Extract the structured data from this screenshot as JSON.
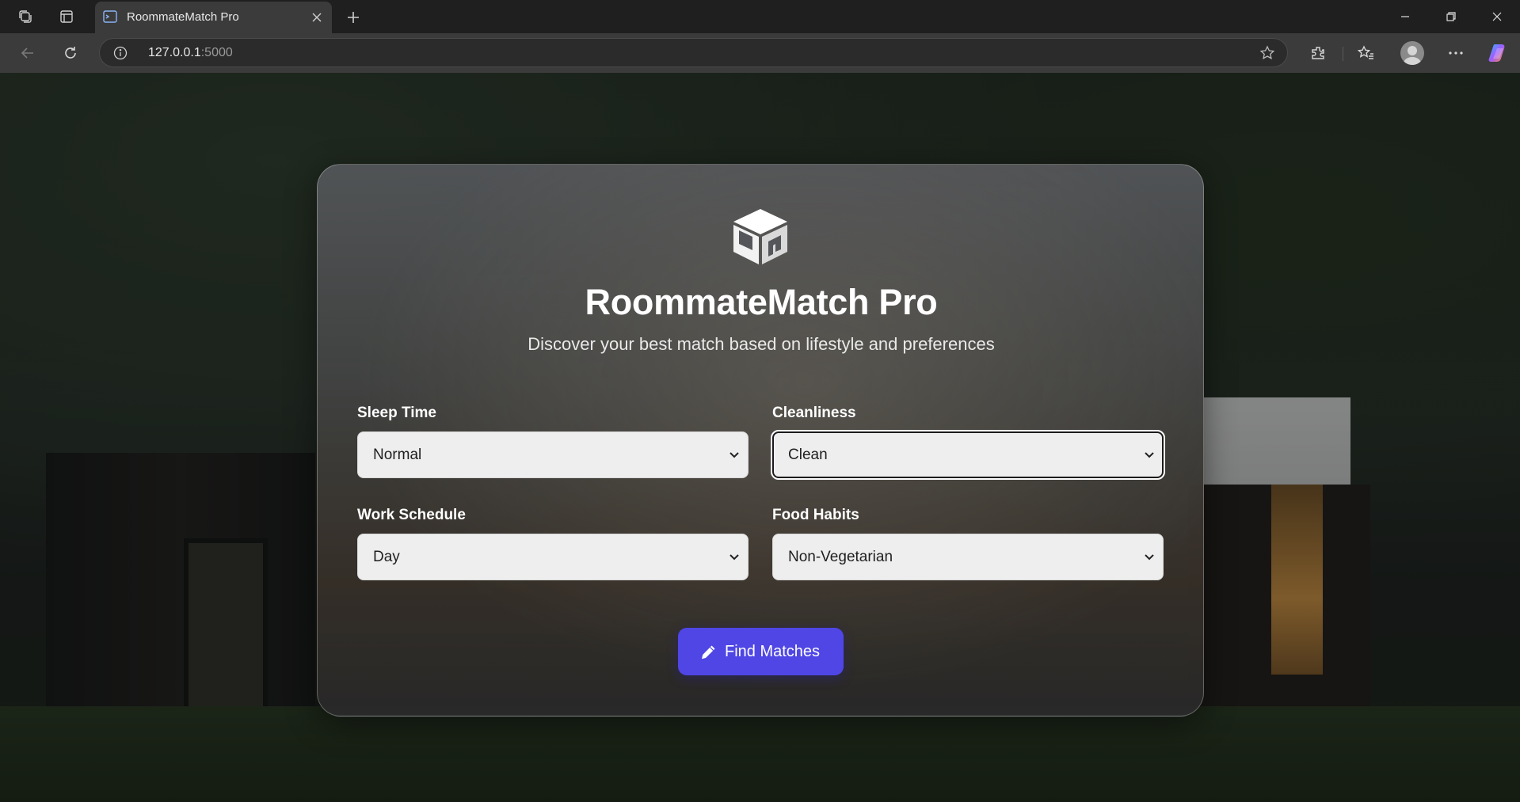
{
  "browser": {
    "tab_title": "RoommateMatch Pro",
    "url_host": "127.0.0.1",
    "url_port": ":5000"
  },
  "app": {
    "title": "RoommateMatch Pro",
    "subtitle": "Discover your best match based on lifestyle and preferences",
    "logo_icon": "cube-logo-icon"
  },
  "form": {
    "sleep_time": {
      "label": "Sleep Time",
      "value": "Normal"
    },
    "cleanliness": {
      "label": "Cleanliness",
      "value": "Clean"
    },
    "work_schedule": {
      "label": "Work Schedule",
      "value": "Day"
    },
    "food_habits": {
      "label": "Food Habits",
      "value": "Non-Vegetarian"
    },
    "submit": {
      "label": "Find Matches",
      "icon": "pencil-icon"
    }
  },
  "colors": {
    "accent": "#4f46e5",
    "chrome_tabbar": "#1f1f1f",
    "chrome_toolbar": "#3b3b3b"
  }
}
